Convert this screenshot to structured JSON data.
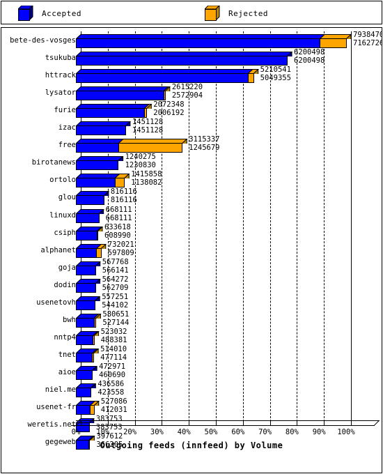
{
  "legend": {
    "items": [
      {
        "label": "Accepted",
        "color": "#0000ff",
        "shade": "#00008b",
        "icon": "cube-icon"
      },
      {
        "label": "Rejected",
        "color": "#ffa500",
        "shade": "#b8860b",
        "icon": "cube-icon"
      }
    ]
  },
  "chart_data": {
    "type": "bar",
    "orientation": "horizontal",
    "stacked": true,
    "title": "",
    "xlabel": "Outgoing feeds (innfeed) by Volume",
    "ylabel": "",
    "xlim": [
      0,
      100
    ],
    "xtick_labels": [
      "0%",
      "10%",
      "20%",
      "30%",
      "40%",
      "50%",
      "60%",
      "70%",
      "80%",
      "90%",
      "100%"
    ],
    "xtick_values": [
      0,
      10,
      20,
      30,
      40,
      50,
      60,
      70,
      80,
      90,
      100
    ],
    "grid": true,
    "grid_style": "dashed-vertical",
    "legend_position": "top",
    "value_label_format": "total over accepted",
    "max_value": 7938470,
    "categories": [
      "bete-des-vosges",
      "tsukuba",
      "httrack",
      "lysator",
      "furie",
      "izac",
      "free",
      "birotanews",
      "ortolo",
      "glou",
      "linuxd",
      "csiph",
      "alphanet",
      "goja",
      "dodin",
      "usenetovh",
      "bwh",
      "nntp4",
      "tnet",
      "aioe",
      "niel.me",
      "usenet-fr",
      "weretis.net",
      "gegeweb"
    ],
    "series": [
      {
        "name": "Accepted",
        "color": "#0000ff",
        "values": [
          7162726,
          6200498,
          5049355,
          2572904,
          2006192,
          1451128,
          1245679,
          1230830,
          1138082,
          816116,
          668111,
          608990,
          597809,
          566141,
          562709,
          544102,
          527144,
          488381,
          477114,
          460690,
          423558,
          412031,
          383753,
          366205
        ]
      },
      {
        "name": "Rejected",
        "color": "#ffa500",
        "values": [
          775744,
          0,
          161186,
          42316,
          66156,
          0,
          1869658,
          9445,
          277776,
          0,
          0,
          24628,
          134212,
          1627,
          1563,
          13149,
          53507,
          34651,
          36896,
          12281,
          13028,
          115055,
          0,
          31407
        ]
      }
    ],
    "totals": [
      7938470,
      6200498,
      5210541,
      2615220,
      2072348,
      1451128,
      3115337,
      1240275,
      1415858,
      816116,
      668111,
      633618,
      732021,
      567768,
      564272,
      557251,
      580651,
      523032,
      514010,
      472971,
      436586,
      527086,
      383753,
      397612
    ],
    "rows": [
      {
        "category": "bete-des-vosges",
        "total": 7938470,
        "accepted": 7162726
      },
      {
        "category": "tsukuba",
        "total": 6200498,
        "accepted": 6200498
      },
      {
        "category": "httrack",
        "total": 5210541,
        "accepted": 5049355
      },
      {
        "category": "lysator",
        "total": 2615220,
        "accepted": 2572904
      },
      {
        "category": "furie",
        "total": 2072348,
        "accepted": 2006192
      },
      {
        "category": "izac",
        "total": 1451128,
        "accepted": 1451128
      },
      {
        "category": "free",
        "total": 3115337,
        "accepted": 1245679
      },
      {
        "category": "birotanews",
        "total": 1240275,
        "accepted": 1230830
      },
      {
        "category": "ortolo",
        "total": 1415858,
        "accepted": 1138082
      },
      {
        "category": "glou",
        "total": 816116,
        "accepted": 816116
      },
      {
        "category": "linuxd",
        "total": 668111,
        "accepted": 668111
      },
      {
        "category": "csiph",
        "total": 633618,
        "accepted": 608990
      },
      {
        "category": "alphanet",
        "total": 732021,
        "accepted": 597809
      },
      {
        "category": "goja",
        "total": 567768,
        "accepted": 566141
      },
      {
        "category": "dodin",
        "total": 564272,
        "accepted": 562709
      },
      {
        "category": "usenetovh",
        "total": 557251,
        "accepted": 544102
      },
      {
        "category": "bwh",
        "total": 580651,
        "accepted": 527144
      },
      {
        "category": "nntp4",
        "total": 523032,
        "accepted": 488381
      },
      {
        "category": "tnet",
        "total": 514010,
        "accepted": 477114
      },
      {
        "category": "aioe",
        "total": 472971,
        "accepted": 460690
      },
      {
        "category": "niel.me",
        "total": 436586,
        "accepted": 423558
      },
      {
        "category": "usenet-fr",
        "total": 527086,
        "accepted": 412031
      },
      {
        "category": "weretis.net",
        "total": 383753,
        "accepted": 383753
      },
      {
        "category": "gegeweb",
        "total": 397612,
        "accepted": 366205
      }
    ]
  }
}
